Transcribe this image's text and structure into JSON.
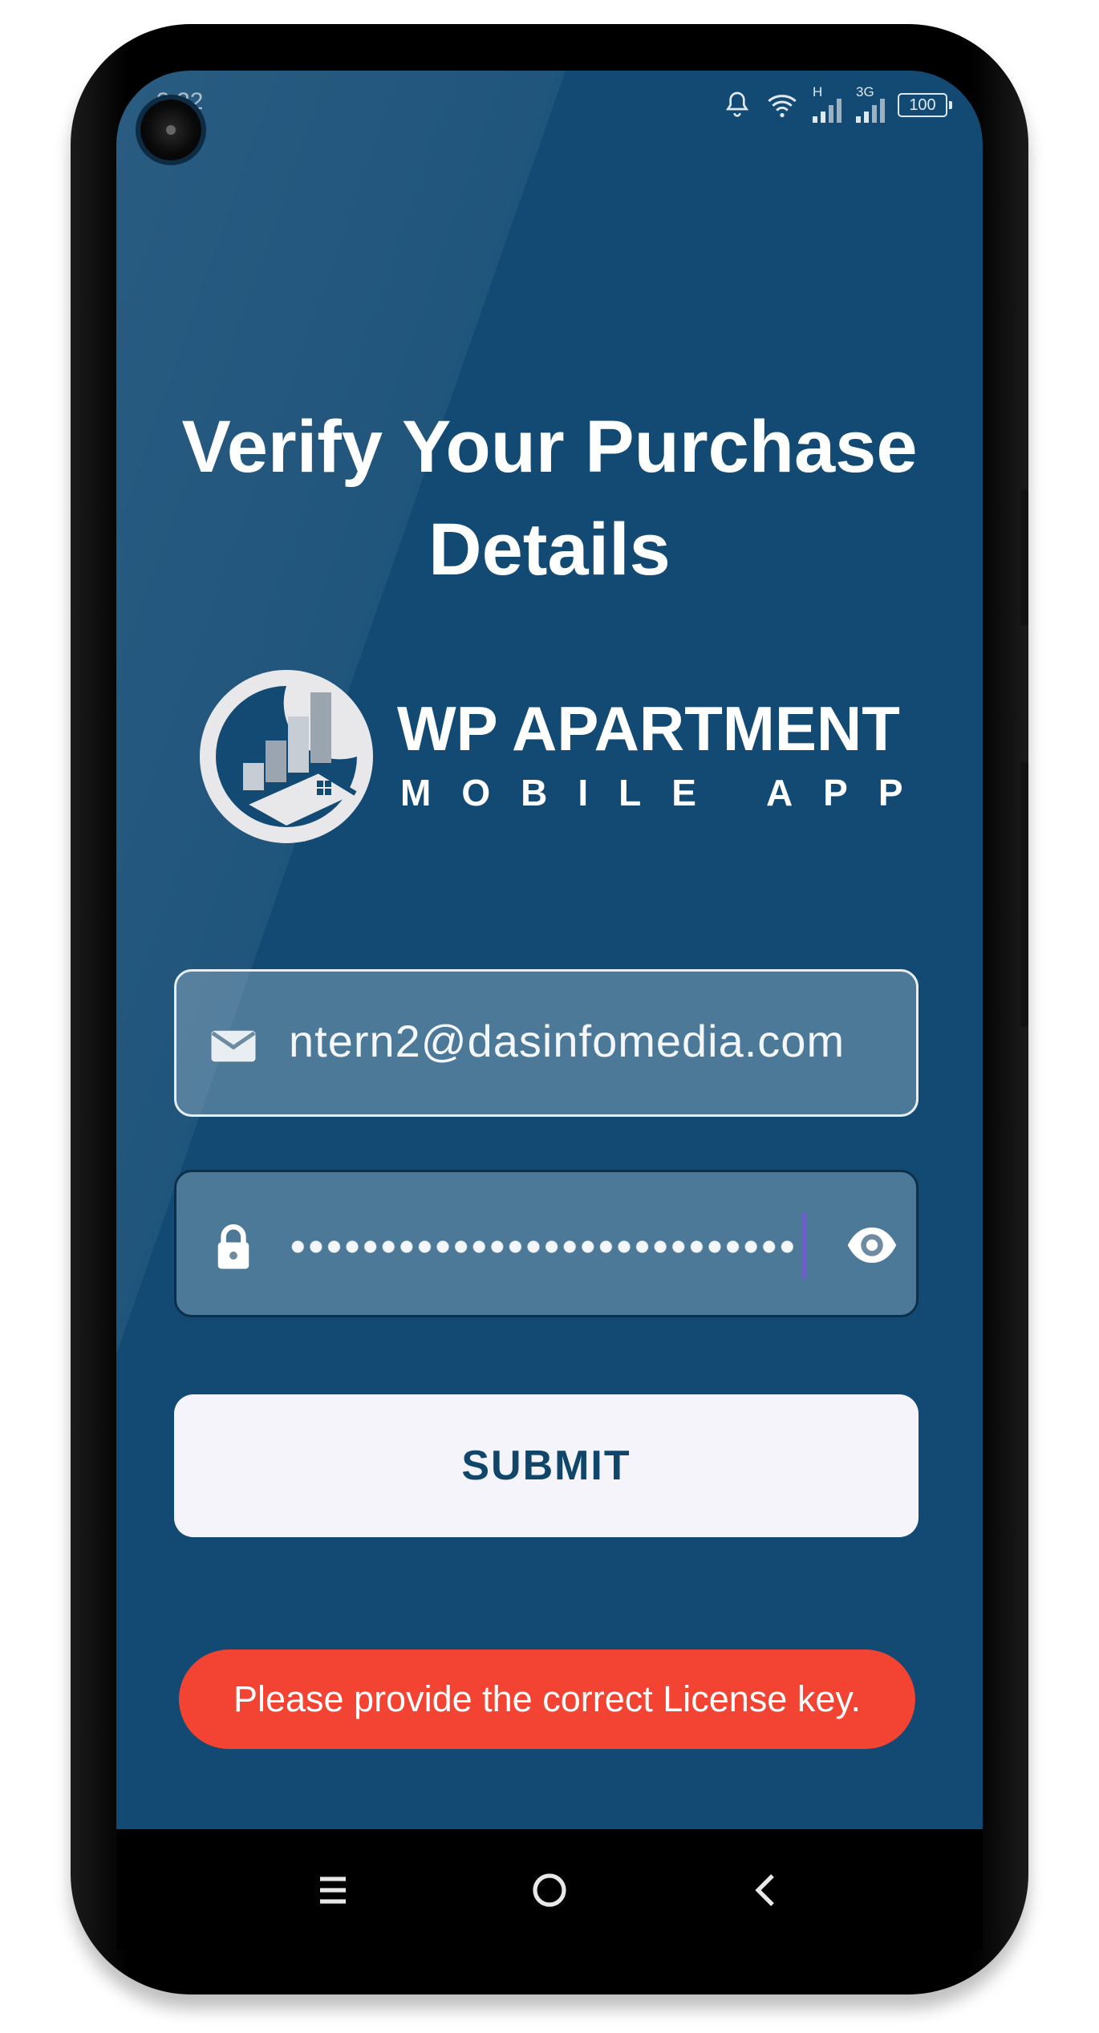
{
  "status_bar": {
    "time": "3:22",
    "battery": "100",
    "network_labels": [
      "H",
      "3G"
    ]
  },
  "screen": {
    "title_line1": "Verify Your Purchase",
    "title_line2": "Details"
  },
  "logo": {
    "brand": "WP APARTMENT",
    "subtitle": "MOBILE APP"
  },
  "form": {
    "email": {
      "icon": "mail-icon",
      "value": "ntern2@dasinfomedia.com"
    },
    "password": {
      "icon": "lock-icon",
      "masked": true,
      "toggle_icon": "eye-icon"
    },
    "submit_label": "SUBMIT"
  },
  "toast": {
    "message": "Please provide the correct License key.",
    "color": "#f24333"
  },
  "nav_bar": {
    "buttons": [
      "menu-icon",
      "home-icon",
      "back-icon"
    ]
  },
  "colors": {
    "background": "#124a73",
    "button": "#f4f4fa",
    "button_text": "#11466b",
    "toast": "#f24333"
  }
}
